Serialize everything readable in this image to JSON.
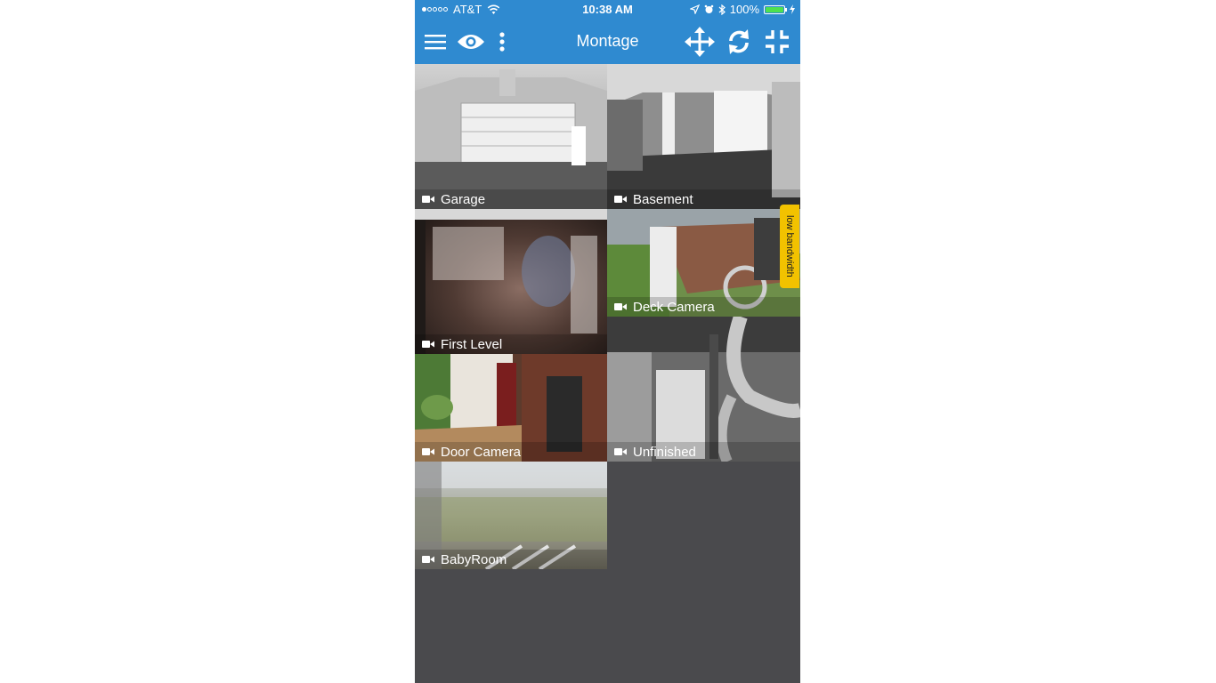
{
  "status_bar": {
    "carrier": "AT&T",
    "time": "10:38 AM",
    "battery": "100%",
    "signal_dots_filled": 1,
    "signal_dots_total": 5,
    "battery_level": 1.0
  },
  "nav": {
    "title": "Montage",
    "icons": [
      "menu-icon",
      "eye-icon",
      "more-vertical-icon",
      "move-icon",
      "refresh-icon",
      "compress-icon"
    ]
  },
  "cameras": [
    {
      "name": "Garage"
    },
    {
      "name": "Basement"
    },
    {
      "name": "First Level"
    },
    {
      "name": "Deck Camera"
    },
    {
      "name": "Door Camera"
    },
    {
      "name": "Unfinished"
    },
    {
      "name": "BabyRoom"
    }
  ],
  "badge": {
    "text": "low bandwidth"
  },
  "colors": {
    "accent": "#2f8ad0",
    "background": "#4a4a4d",
    "badge": "#f2c200",
    "battery_fill": "#4ee14e"
  }
}
